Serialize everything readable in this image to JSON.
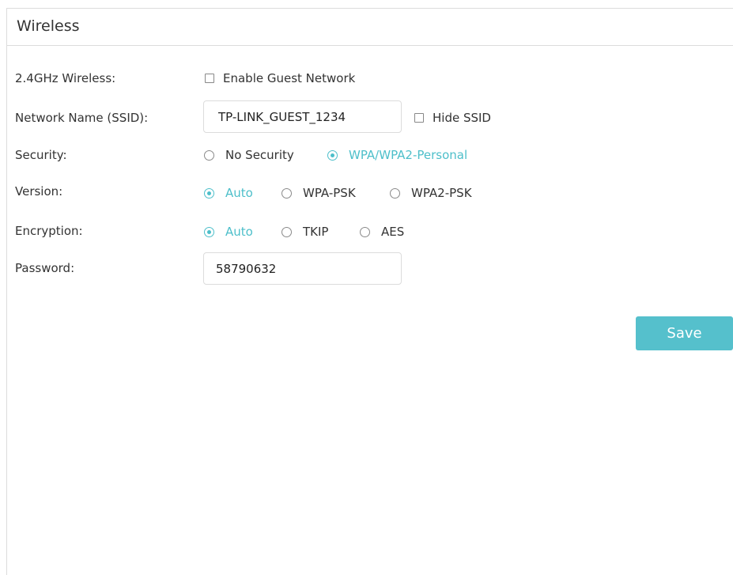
{
  "panel": {
    "title": "Wireless"
  },
  "rows": {
    "band": {
      "label": "2.4GHz Wireless:",
      "guest_option": "Enable Guest Network"
    },
    "ssid": {
      "label": "Network Name (SSID):",
      "value": "TP-LINK_GUEST_1234",
      "hide_option": "Hide SSID"
    },
    "security": {
      "label": "Security:",
      "options": [
        "No Security",
        "WPA/WPA2-Personal"
      ],
      "selected": "WPA/WPA2-Personal"
    },
    "version": {
      "label": "Version:",
      "options": [
        "Auto",
        "WPA-PSK",
        "WPA2-PSK"
      ],
      "selected": "Auto"
    },
    "encryption": {
      "label": "Encryption:",
      "options": [
        "Auto",
        "TKIP",
        "AES"
      ],
      "selected": "Auto"
    },
    "password": {
      "label": "Password:",
      "value": "58790632"
    }
  },
  "actions": {
    "save_label": "Save"
  },
  "colors": {
    "accent": "#4dbfca",
    "button": "#55c0cc",
    "border": "#dcdcdc",
    "text": "#333333"
  }
}
